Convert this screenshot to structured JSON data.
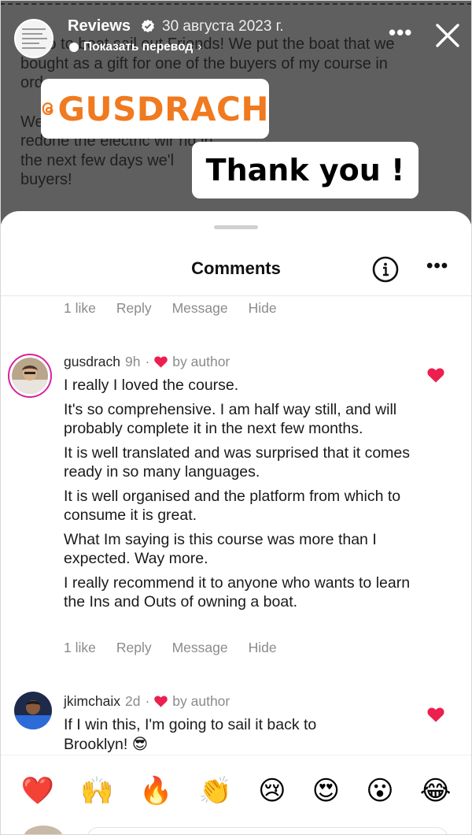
{
  "story": {
    "account_name": "Reviews",
    "date": "30 августа 2023 г.",
    "translate_label": "Показать перевод",
    "post_paragraphs": [
      "Hello to boat sail out Friends! We put the boat that we\nbought as a gift for one of the buyers of my course in\nord",
      "We                                              navigation lights and\nredone the electric wir                          nd in\nthe next few days we'l\nbuyers!"
    ],
    "tag_sticker": "GUSDRACH",
    "text_sticker": "Thank you !"
  },
  "comments_sheet": {
    "title": "Comments",
    "prev_actions": {
      "likes": "1 like",
      "reply": "Reply",
      "message": "Message",
      "hide": "Hide"
    },
    "comments": [
      {
        "username": "gusdrach",
        "time": "9h",
        "by_author": "by author",
        "paragraphs": [
          "I really I loved the course.",
          "It's so comprehensive. I am half way still, and will probably complete it in the next few months.",
          "It is well translated and was surprised that it comes ready in so many languages.",
          "It is well organised and the platform from which to consume it is great.",
          "What Im saying is this course was more than I expected. Way more.",
          "I really recommend it to anyone who wants to learn the Ins and Outs of owning a boat."
        ],
        "actions": {
          "likes": "1 like",
          "reply": "Reply",
          "message": "Message",
          "hide": "Hide"
        }
      },
      {
        "username": "jkimchaix",
        "time": "2d",
        "by_author": "by author",
        "paragraphs": [
          "If I win this, I'm going to sail it back to Brooklyn! 😎"
        ]
      }
    ],
    "emoji_bar": [
      "❤️",
      "🙌",
      "🔥",
      "👏",
      "😢",
      "😍",
      "😮",
      "😂"
    ]
  },
  "colors": {
    "heart": "#ed1f4f",
    "tag_orange": "#f07a1f",
    "muted": "#8b8b8b"
  },
  "icons": [
    "verified-badge-icon",
    "chevron-right-icon",
    "more-icon",
    "close-icon",
    "info-icon",
    "heart-icon",
    "threads-icon"
  ]
}
